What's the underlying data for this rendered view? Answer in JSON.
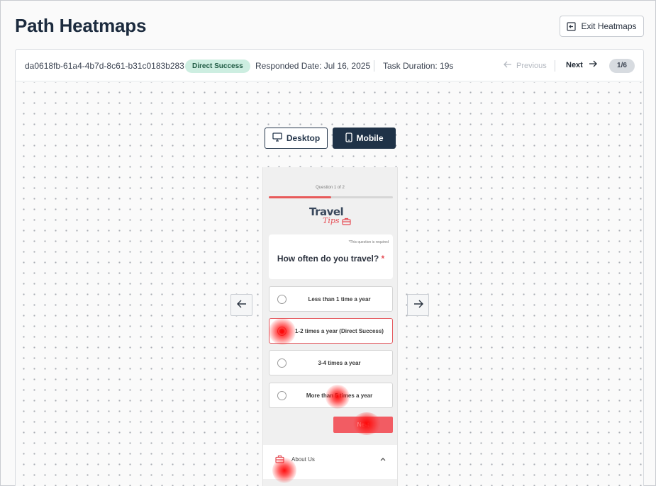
{
  "page": {
    "title": "Path Heatmaps",
    "exit_label": "Exit Heatmaps"
  },
  "response": {
    "id": "da0618fb-61a4-4b7d-8c61-b31c0183b283",
    "badge": "Direct Success",
    "responded_date": "Responded Date: Jul 16, 2025",
    "task_duration": "Task Duration: 19s",
    "previous_label": "Previous",
    "next_label": "Next",
    "page_indicator": "1/6"
  },
  "device_toggle": {
    "desktop_label": "Desktop",
    "mobile_label": "Mobile",
    "active": "Mobile"
  },
  "survey": {
    "question_counter": "Question 1 of 2",
    "progress_fraction": 0.5,
    "logo_line1": "Travel",
    "logo_line2": "Tips",
    "required_note": "*This question is required",
    "question": "How often do you travel?",
    "required_mark": "*",
    "options": [
      {
        "label": "Less than 1 time a year",
        "selected": false
      },
      {
        "label": "1-2 times a year (Direct Success)",
        "selected": true
      },
      {
        "label": "3-4 times a year",
        "selected": false
      },
      {
        "label": "More than 5 times a year",
        "selected": false
      }
    ],
    "next_button": "Next",
    "footer_about": "About Us"
  },
  "colors": {
    "brand_navy": "#1f3247",
    "accent_red": "#f25c63",
    "badge_bg": "#cdeee1",
    "heat": "#ff0000"
  },
  "icons": {
    "exit": "exit-icon",
    "previous": "arrow-left-icon",
    "next": "arrow-right-icon",
    "desktop": "monitor-icon",
    "mobile": "smartphone-icon",
    "about": "briefcase-icon",
    "collapse": "chevron-up-icon"
  }
}
